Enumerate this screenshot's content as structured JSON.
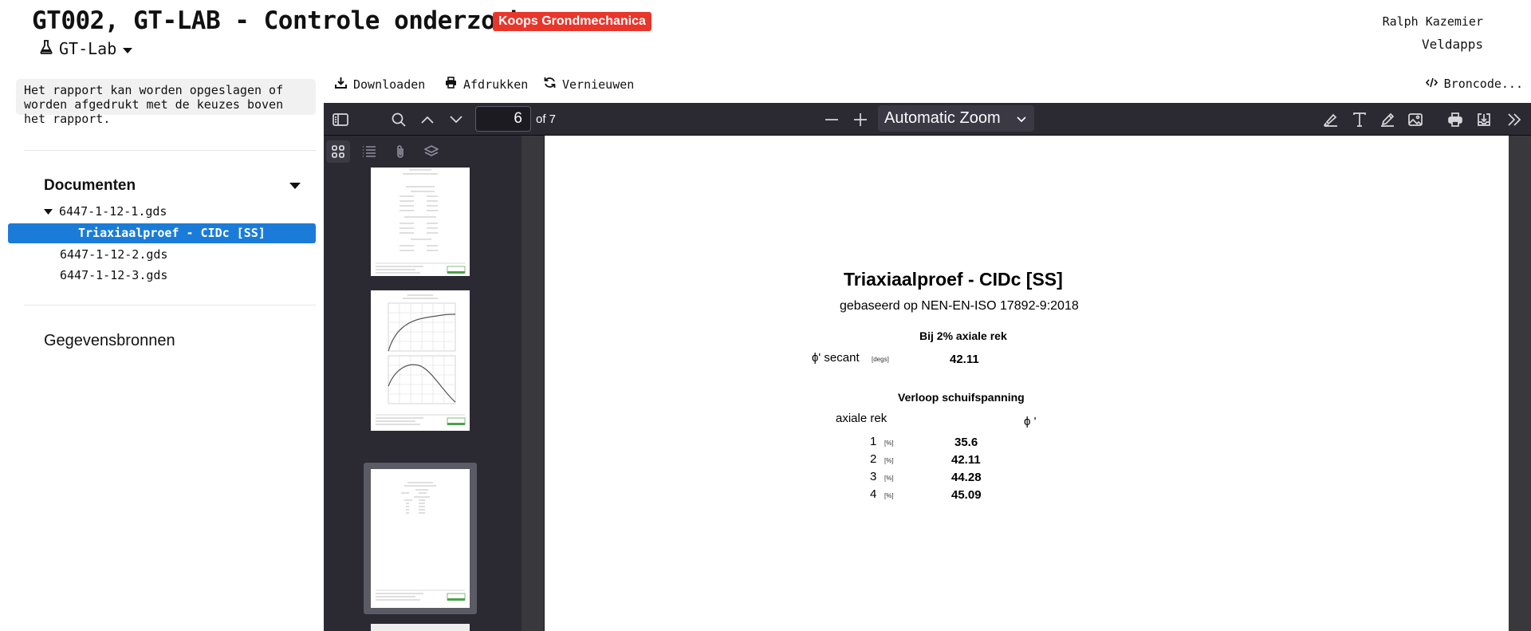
{
  "header": {
    "title": "GT002, GT-LAB - Controle onderzoek",
    "badge": "Koops Grondmechanica",
    "project": "GT-Lab",
    "user": "Ralph Kazemier",
    "org": "Veldapps"
  },
  "sidebar": {
    "info": "Het rapport kan worden opgeslagen of worden afgedrukt met de keuzes boven het rapport.",
    "documents_heading": "Documenten",
    "tree": [
      {
        "label": "6447-1-12-1.gds",
        "expanded": true
      },
      {
        "label": "Triaxiaalproef - CIDc [SS]",
        "selected": true
      },
      {
        "label": "6447-1-12-2.gds"
      },
      {
        "label": "6447-1-12-3.gds"
      }
    ],
    "sources_heading": "Gegevensbronnen"
  },
  "actions": {
    "download": "Downloaden",
    "print": "Afdrukken",
    "refresh": "Vernieuwen",
    "source": "Broncode..."
  },
  "viewer": {
    "page_number": "6",
    "page_count": "of 7",
    "zoom": "Automatic Zoom",
    "colors": {
      "toolbar": "#2b2a33",
      "background": "#38383d",
      "selection": "#1a7cd8",
      "badge": "#e8362b"
    }
  },
  "report": {
    "title": "Triaxiaalproef - CIDc [SS]",
    "subtitle": "gebaseerd op NEN-EN-ISO 17892-9:2018",
    "section1": "Bij 2% axiale rek",
    "phi_secant_label": "ϕ' secant",
    "phi_secant_unit": "[degs]",
    "phi_secant_value": "42.11",
    "section2": "Verloop schuifspanning",
    "col_strain": "axiale rek",
    "col_phi": "ϕ '",
    "rows": [
      {
        "strain": "1",
        "unit": "[%]",
        "phi": "35.6"
      },
      {
        "strain": "2",
        "unit": "[%]",
        "phi": "42.11"
      },
      {
        "strain": "3",
        "unit": "[%]",
        "phi": "44.28"
      },
      {
        "strain": "4",
        "unit": "[%]",
        "phi": "45.09"
      }
    ]
  }
}
